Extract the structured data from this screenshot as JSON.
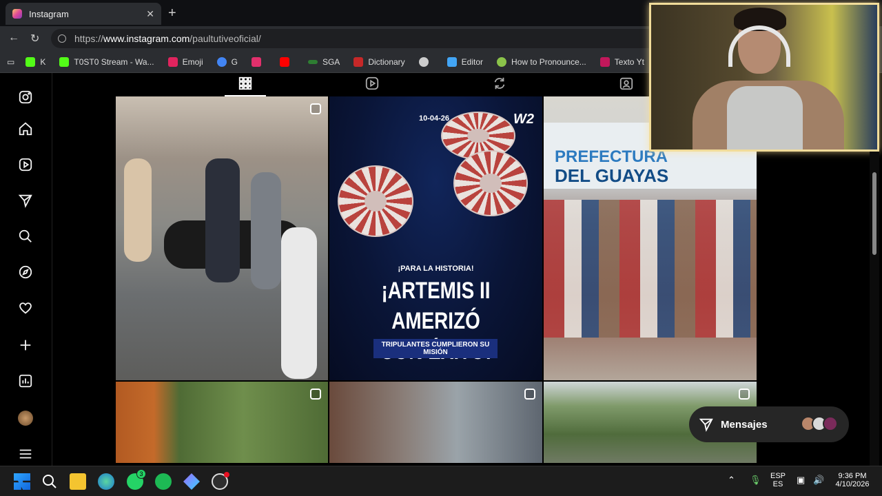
{
  "browser": {
    "tab_title": "Instagram",
    "url_prefix": "https://",
    "url_host": "www.instagram.com",
    "url_path": "/paultutiveoficial/",
    "bookmarks": [
      {
        "label": "K",
        "color": "#53fc18"
      },
      {
        "label": "T0ST0 Stream - Wa...",
        "color": "#53fc18"
      },
      {
        "label": "Emoji",
        "color": "#e0245e"
      },
      {
        "label": "G",
        "color": "#4285f4"
      },
      {
        "label": "",
        "color": "#e1306c"
      },
      {
        "label": "",
        "color": "#ff0000"
      },
      {
        "label": "SGA",
        "color": "#2e7d32"
      },
      {
        "label": "Dictionary",
        "color": "#c62828"
      },
      {
        "label": "",
        "color": "#cccccc"
      },
      {
        "label": "Editor",
        "color": "#42a5f5"
      },
      {
        "label": "How to Pronounce...",
        "color": "#8bc34a"
      },
      {
        "label": "Texto Yt",
        "color": "#c2185b"
      }
    ]
  },
  "post_news": {
    "date": "10-04-26",
    "logo": "W2",
    "kicker": "¡PARA LA HISTORIA!",
    "headline_line1": "¡ARTEMIS II AMERIZÓ",
    "headline_line2": "CON ÉXITO!",
    "sub": "TRIPULANTES CUMPLIERON SU MISIÓN"
  },
  "post_pref": {
    "title1": "PREFECTURA",
    "title2": "DEL GUAYAS"
  },
  "messages": {
    "label": "Mensajes"
  },
  "taskbar": {
    "lang1": "ESP",
    "lang2": "ES",
    "time": "9:36 PM",
    "date": "4/10/2026",
    "whatsapp_badge": "3"
  },
  "colors": {
    "accent": "#f1dc9a",
    "news_banner": "#1a2f7d"
  }
}
